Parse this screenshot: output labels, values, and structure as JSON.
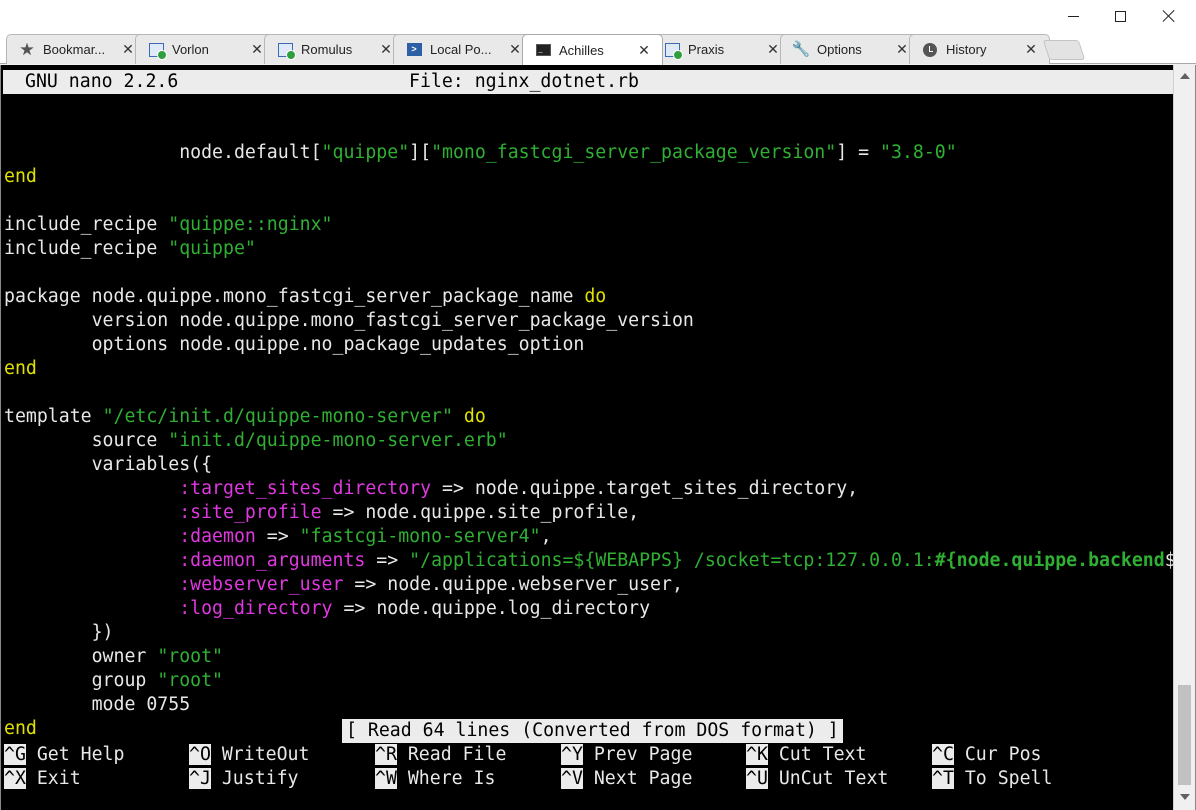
{
  "window": {
    "minimize_glyph": "minimize",
    "maximize_glyph": "maximize",
    "close_glyph": "close"
  },
  "tabs": [
    {
      "label": "Bookmar...",
      "icon": "star-icon",
      "close": "✕",
      "active": false
    },
    {
      "label": "Vorlon",
      "icon": "remote-desktop-icon",
      "close": "✕",
      "active": false
    },
    {
      "label": "Romulus",
      "icon": "remote-desktop-icon",
      "close": "✕",
      "active": false
    },
    {
      "label": "Local Po...",
      "icon": "powershell-icon",
      "close": "✕",
      "active": false
    },
    {
      "label": "Achilles",
      "icon": "terminal-icon",
      "close": "✕",
      "active": true
    },
    {
      "label": "Praxis",
      "icon": "remote-desktop-icon",
      "close": "✕",
      "active": false
    },
    {
      "label": "Options",
      "icon": "wrench-icon",
      "close": "✕",
      "active": false
    },
    {
      "label": "History",
      "icon": "clock-icon",
      "close": "✕",
      "active": false
    }
  ],
  "nano": {
    "version": "GNU nano 2.2.6",
    "file": "File: nginx_dotnet.rb",
    "status": "[ Read 64 lines (Converted from DOS format) ]"
  },
  "code_lines": [
    [],
    [
      {
        "t": "                node.default[",
        "c": "pl"
      },
      {
        "t": "\"quippe\"",
        "c": "str"
      },
      {
        "t": "][",
        "c": "pl"
      },
      {
        "t": "\"mono_fastcgi_server_package_version\"",
        "c": "str"
      },
      {
        "t": "] = ",
        "c": "pl"
      },
      {
        "t": "\"3.8-0\"",
        "c": "str"
      }
    ],
    [
      {
        "t": "end",
        "c": "kw"
      }
    ],
    [],
    [
      {
        "t": "include_recipe ",
        "c": "pl"
      },
      {
        "t": "\"quippe::nginx\"",
        "c": "str"
      }
    ],
    [
      {
        "t": "include_recipe ",
        "c": "pl"
      },
      {
        "t": "\"quippe\"",
        "c": "str"
      }
    ],
    [],
    [
      {
        "t": "package node.quippe.mono_fastcgi_server_package_name ",
        "c": "pl"
      },
      {
        "t": "do",
        "c": "kw"
      }
    ],
    [
      {
        "t": "        version node.quippe.mono_fastcgi_server_package_version",
        "c": "pl"
      }
    ],
    [
      {
        "t": "        options node.quippe.no_package_updates_option",
        "c": "pl"
      }
    ],
    [
      {
        "t": "end",
        "c": "kw"
      }
    ],
    [],
    [
      {
        "t": "template ",
        "c": "pl"
      },
      {
        "t": "\"/etc/init.d/quippe-mono-server\"",
        "c": "str"
      },
      {
        "t": " ",
        "c": "pl"
      },
      {
        "t": "do",
        "c": "kw"
      }
    ],
    [
      {
        "t": "        source ",
        "c": "pl"
      },
      {
        "t": "\"init.d/quippe-mono-server.erb\"",
        "c": "str"
      }
    ],
    [
      {
        "t": "        variables({",
        "c": "pl"
      }
    ],
    [
      {
        "t": "                ",
        "c": "pl"
      },
      {
        "t": ":target_sites_directory",
        "c": "sym"
      },
      {
        "t": " => node.quippe.target_sites_directory,",
        "c": "pl"
      }
    ],
    [
      {
        "t": "                ",
        "c": "pl"
      },
      {
        "t": ":site_profile",
        "c": "sym"
      },
      {
        "t": " => node.quippe.site_profile,",
        "c": "pl"
      }
    ],
    [
      {
        "t": "                ",
        "c": "pl"
      },
      {
        "t": ":daemon",
        "c": "sym"
      },
      {
        "t": " => ",
        "c": "pl"
      },
      {
        "t": "\"fastcgi-mono-server4\"",
        "c": "str"
      },
      {
        "t": ",",
        "c": "pl"
      }
    ],
    [
      {
        "t": "                ",
        "c": "pl"
      },
      {
        "t": ":daemon_arguments",
        "c": "sym"
      },
      {
        "t": " => ",
        "c": "pl"
      },
      {
        "t": "\"/applications=${WEBAPPS} /socket=tcp:127.0.0.1:",
        "c": "str"
      },
      {
        "t": "#{node.quippe.backend",
        "c": "str bold"
      },
      {
        "t": "$",
        "c": "pl"
      }
    ],
    [
      {
        "t": "                ",
        "c": "pl"
      },
      {
        "t": ":webserver_user",
        "c": "sym"
      },
      {
        "t": " => node.quippe.webserver_user,",
        "c": "pl"
      }
    ],
    [
      {
        "t": "                ",
        "c": "pl"
      },
      {
        "t": ":log_directory",
        "c": "sym"
      },
      {
        "t": " => node.quippe.log_directory",
        "c": "pl"
      }
    ],
    [
      {
        "t": "        })",
        "c": "pl"
      }
    ],
    [
      {
        "t": "        owner ",
        "c": "pl"
      },
      {
        "t": "\"root\"",
        "c": "str"
      }
    ],
    [
      {
        "t": "        group ",
        "c": "pl"
      },
      {
        "t": "\"root\"",
        "c": "str"
      }
    ],
    [
      {
        "t": "        mode 0755",
        "c": "pl"
      }
    ],
    [
      {
        "t": "end",
        "c": "kw"
      }
    ]
  ],
  "shortcuts": [
    {
      "key": "^G",
      "label": " Get Help"
    },
    {
      "key": "^O",
      "label": " WriteOut"
    },
    {
      "key": "^R",
      "label": " Read File"
    },
    {
      "key": "^Y",
      "label": " Prev Page"
    },
    {
      "key": "^K",
      "label": " Cut Text"
    },
    {
      "key": "^C",
      "label": " Cur Pos"
    },
    {
      "key": "^X",
      "label": " Exit"
    },
    {
      "key": "^J",
      "label": " Justify"
    },
    {
      "key": "^W",
      "label": " Where Is"
    },
    {
      "key": "^V",
      "label": " Next Page"
    },
    {
      "key": "^U",
      "label": " UnCut Text"
    },
    {
      "key": "^T",
      "label": " To Spell"
    }
  ]
}
